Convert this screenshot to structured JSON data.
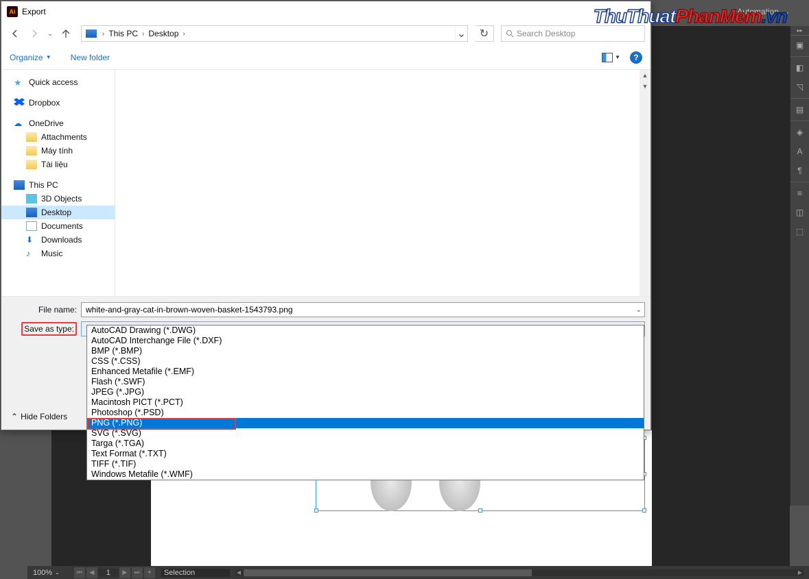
{
  "watermark": {
    "part1": "ThuThuat",
    "part2": "PhanMem",
    "part3": ".vn"
  },
  "ai": {
    "automation": "Automation",
    "zoom": "100%",
    "nav_page": "1",
    "mode": "Selection"
  },
  "dialog": {
    "title": "Export",
    "breadcrumbs": [
      "This PC",
      "Desktop"
    ],
    "search_placeholder": "Search Desktop",
    "organize": "Organize",
    "new_folder": "New folder",
    "nav_groups": [
      {
        "items": [
          {
            "label": "Quick access",
            "icon": "star"
          }
        ]
      },
      {
        "items": [
          {
            "label": "Dropbox",
            "icon": "dropbox"
          }
        ]
      },
      {
        "items": [
          {
            "label": "OneDrive",
            "icon": "cloud"
          },
          {
            "label": "Attachments",
            "icon": "folder",
            "indent": true
          },
          {
            "label": "Máy tính",
            "icon": "folder",
            "indent": true
          },
          {
            "label": "Tài liệu",
            "icon": "folder",
            "indent": true
          }
        ]
      },
      {
        "items": [
          {
            "label": "This PC",
            "icon": "pc"
          },
          {
            "label": "3D Objects",
            "icon": "threed",
            "indent": true
          },
          {
            "label": "Desktop",
            "icon": "desktop",
            "indent": true,
            "selected": true
          },
          {
            "label": "Documents",
            "icon": "doc",
            "indent": true
          },
          {
            "label": "Downloads",
            "icon": "down",
            "indent": true
          },
          {
            "label": "Music",
            "icon": "music",
            "indent": true
          }
        ]
      }
    ],
    "file_name_label": "File name:",
    "file_name_value": "white-and-gray-cat-in-brown-woven-basket-1543793.png",
    "save_type_label": "Save as type:",
    "save_type_value": "PNG (*.PNG)",
    "hide_folders": "Hide Folders",
    "type_options": [
      "AutoCAD Drawing (*.DWG)",
      "AutoCAD Interchange File (*.DXF)",
      "BMP (*.BMP)",
      "CSS (*.CSS)",
      "Enhanced Metafile (*.EMF)",
      "Flash (*.SWF)",
      "JPEG (*.JPG)",
      "Macintosh PICT (*.PCT)",
      "Photoshop (*.PSD)",
      "PNG (*.PNG)",
      "SVG (*.SVG)",
      "Targa (*.TGA)",
      "Text Format (*.TXT)",
      "TIFF (*.TIF)",
      "Windows Metafile (*.WMF)"
    ],
    "selected_option": "PNG (*.PNG)"
  }
}
